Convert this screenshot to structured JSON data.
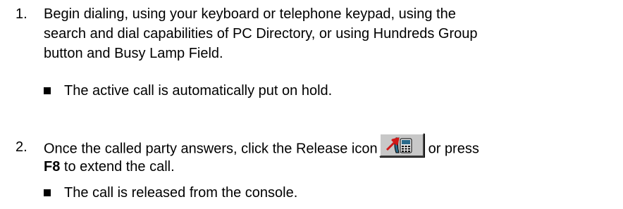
{
  "steps": [
    {
      "number": "1.",
      "lines": [
        "Begin dialing, using your keyboard or telephone keypad, using the",
        "search and dial capabilities of PC Directory, or using Hundreds Group",
        "button and Busy Lamp Field."
      ],
      "bullet": "The active call is automatically put on hold."
    },
    {
      "number": "2.",
      "line1_before_icon": "Once the called party answers, click the Release icon",
      "line1_after_icon": "or press",
      "line2_bold": "F8",
      "line2_rest": " to extend the call.",
      "bullet": "The call is released from the console."
    }
  ],
  "icons": {
    "release": "release-phone-icon"
  },
  "colors": {
    "text": "#000000",
    "button_face": "#c8c8c8",
    "arrow": "#d01818",
    "phone_body": "#2a6a8a"
  }
}
